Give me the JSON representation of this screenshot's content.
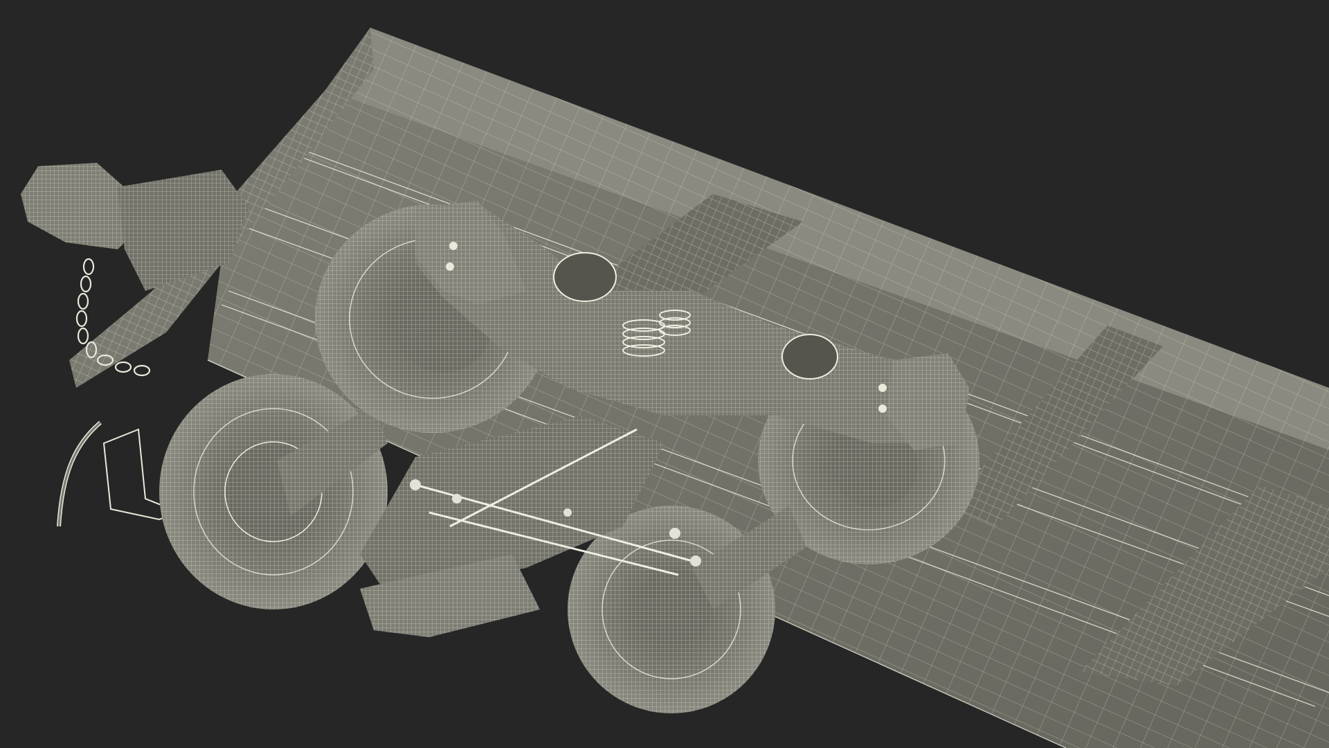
{
  "background_color": "#262626",
  "surface_colors": {
    "frame_dark": "#5a5a52",
    "frame_mid": "#76766d",
    "frame_light": "#8a8a80",
    "wheel_face": "#7a7a70",
    "wheel_inner": "#6b6b62",
    "wire": "#e9e9dc",
    "wire_dim": "#c9c9bb"
  },
  "objects": [
    {
      "name": "railcar-underframe",
      "label": ""
    },
    {
      "name": "bogie-wheelset",
      "label": ""
    },
    {
      "name": "coupler-with-chain",
      "label": ""
    }
  ]
}
